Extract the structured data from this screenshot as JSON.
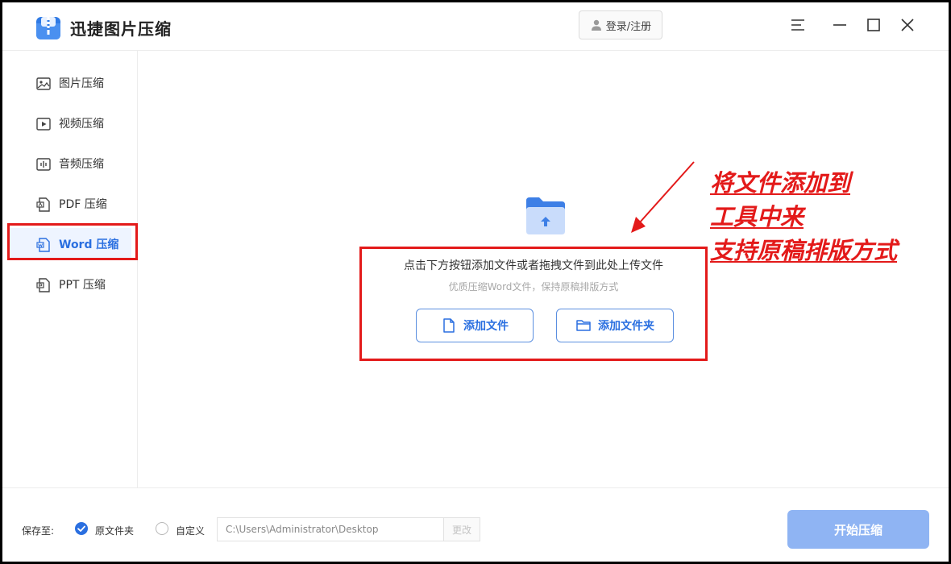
{
  "app": {
    "title": "迅捷图片压缩",
    "login_label": "登录/注册"
  },
  "sidebar": {
    "items": [
      {
        "label": "图片压缩",
        "icon": "image-icon"
      },
      {
        "label": "视频压缩",
        "icon": "video-icon"
      },
      {
        "label": "音频压缩",
        "icon": "audio-icon"
      },
      {
        "label": "PDF 压缩",
        "icon": "pdf-icon"
      },
      {
        "label": "Word 压缩",
        "icon": "word-icon",
        "active": true
      },
      {
        "label": "PPT 压缩",
        "icon": "ppt-icon"
      }
    ]
  },
  "main": {
    "drop_main": "点击下方按钮添加文件或者拖拽文件到此处上传文件",
    "drop_sub": "优质压缩Word文件，保持原稿排版方式",
    "add_file_label": "添加文件",
    "add_folder_label": "添加文件夹"
  },
  "annotation": {
    "lines": [
      "将文件添加到",
      "工具中来",
      "支持原稿排版方式"
    ]
  },
  "footer": {
    "save_label": "保存至:",
    "option_original": "原文件夹",
    "option_custom": "自定义",
    "path_value": "C:\\Users\\Administrator\\Desktop",
    "change_label": "更改",
    "start_label": "开始压缩"
  },
  "colors": {
    "accent": "#2a6fe0",
    "annotation": "#e31a1a",
    "start_button": "#8fb4f3"
  }
}
